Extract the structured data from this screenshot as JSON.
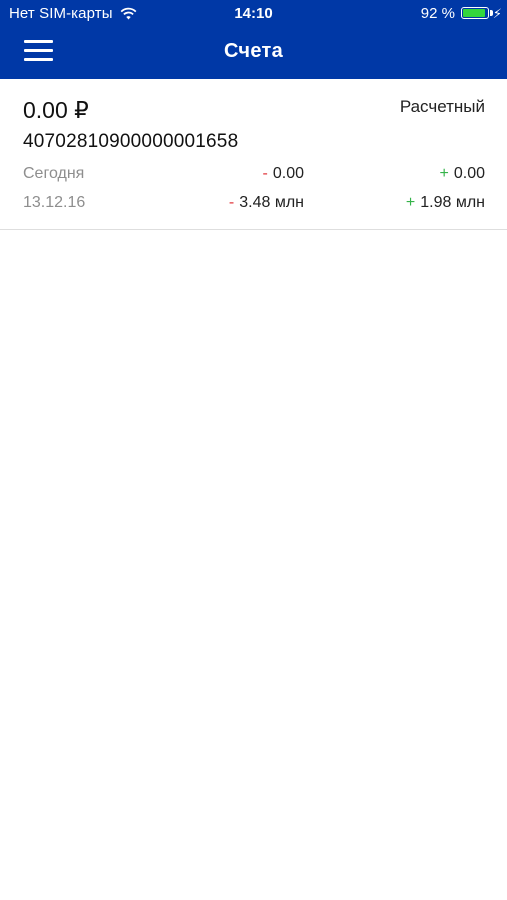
{
  "status_bar": {
    "carrier": "Нет SIM-карты",
    "time": "14:10",
    "battery_percent": "92 %",
    "battery_level": 0.92,
    "wifi_icon": "wifi-icon",
    "charging_icon": "charging-icon"
  },
  "nav": {
    "title": "Счета",
    "menu_icon": "hamburger-menu-icon",
    "bar_color": "#0038a6"
  },
  "account": {
    "balance": "0.00 ₽",
    "type": "Расчетный",
    "number": "40702810900000001658",
    "rows": [
      {
        "label": "Сегодня",
        "debit_sign": "-",
        "debit": "0.00",
        "credit_sign": "+",
        "credit": "0.00"
      },
      {
        "label": "13.12.16",
        "debit_sign": "-",
        "debit": "3.48 млн",
        "credit_sign": "+",
        "credit": "1.98 млн"
      }
    ]
  },
  "colors": {
    "debit": "#e0363b",
    "credit": "#35b34a",
    "battery": "#33d63d"
  }
}
